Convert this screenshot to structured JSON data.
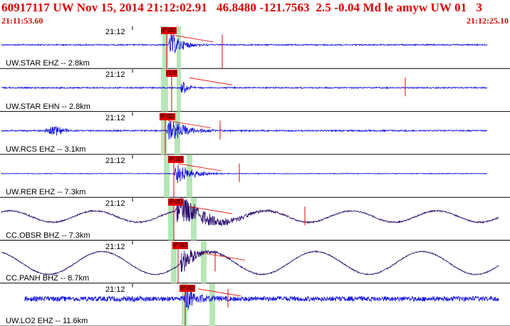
{
  "header": {
    "title": "60917117 UW Nov 15, 2014 21:12:02.91   46.8480 -121.7563  2.5 -0.04 Md le amyw UW 01   3",
    "start_time": "21:11:53.60",
    "end_time": "21:12:25.10"
  },
  "colors": {
    "header_text": "#e00000",
    "trace_blue": "#1010e0",
    "trace_dark": "#2a0a6e",
    "pick_flag": "#e00000",
    "window_band": "#b8e6b8",
    "separator": "#000000"
  },
  "panels": [
    {
      "station": "UW.STAR EHZ -- 2.8km",
      "time_tick": "21:12",
      "pick": "iP:0D"
    },
    {
      "station": "UW.STAR EHN -- 2.8km",
      "time_tick": "21:12",
      "pick": "iS:0"
    },
    {
      "station": "UW.RCS EHZ -- 3.1km",
      "time_tick": "21:12",
      "pick": "iP:0D"
    },
    {
      "station": "UW.RER EHZ -- 7.3km",
      "time_tick": "21:12",
      "pick": "iP:3D"
    },
    {
      "station": "CC.OBSR BHZ -- 7.3km",
      "time_tick": "21:12",
      "pick": "iP:0D"
    },
    {
      "station": "CC.PANH BHZ -- 8.7km",
      "time_tick": "21:12",
      "pick": "iP:0D"
    },
    {
      "station": "UW.LO2 EHZ -- 11.6km",
      "time_tick": "21:12",
      "pick": "iP:0D"
    }
  ]
}
